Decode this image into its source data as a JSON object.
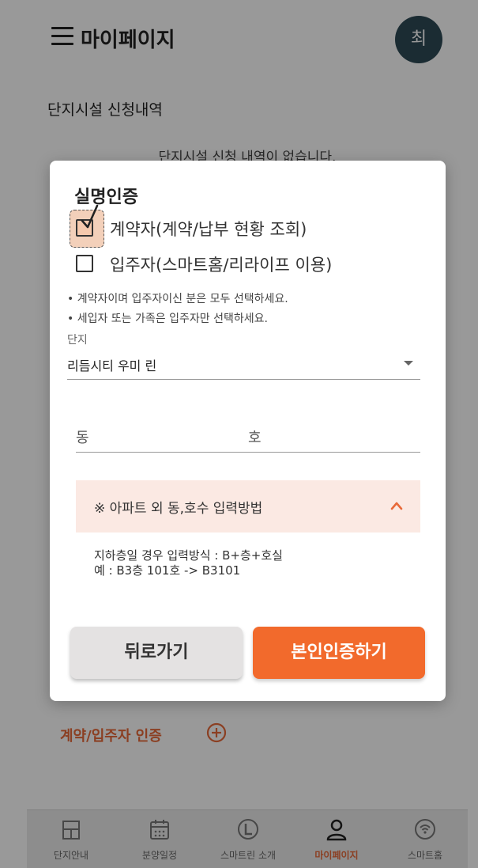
{
  "header": {
    "title": "마이페이지",
    "avatar_text": "최"
  },
  "section": {
    "title": "단지시설 신청내역",
    "empty_message": "단지시설 신청 내역이 없습니다."
  },
  "verify_entry": {
    "label": "계약/입주자 인증"
  },
  "bottom_nav": [
    {
      "label": "단지안내",
      "icon": "building-icon",
      "active": false
    },
    {
      "label": "분양일정",
      "icon": "calendar-icon",
      "active": false
    },
    {
      "label": "스마트린 소개",
      "icon": "brand-l-icon",
      "active": false
    },
    {
      "label": "마이페이지",
      "icon": "person-icon",
      "active": true
    },
    {
      "label": "스마트홈",
      "icon": "smarthome-icon",
      "active": false
    }
  ],
  "modal": {
    "title": "실명인증",
    "options": [
      {
        "label": "계약자(계약/납부 현황 조회)",
        "checked": true
      },
      {
        "label": "입주자(스마트홈/리라이프 이용)",
        "checked": false
      }
    ],
    "notes": [
      "• 계약자이며 입주자이신 분은 모두 선택하세요.",
      "• 세입자 또는 가족은 입주자만 선택하세요."
    ],
    "complex": {
      "label": "단지",
      "value": "리듬시티 우미 린"
    },
    "address": {
      "dong_placeholder": "동",
      "ho_placeholder": "호"
    },
    "info": {
      "title": "※ 아파트 외 동,호수 입력방법",
      "lines": [
        "지하층일 경우 입력방식 : B+층+호실",
        "예 : B3층 101호 -> B3101"
      ]
    },
    "buttons": {
      "back": "뒤로가기",
      "verify": "본인인증하기"
    }
  },
  "colors": {
    "accent": "#f26a2c",
    "avatar_bg": "#2e4a56",
    "info_bg": "#fbe9e3",
    "nav_active": "#e86a3a"
  }
}
